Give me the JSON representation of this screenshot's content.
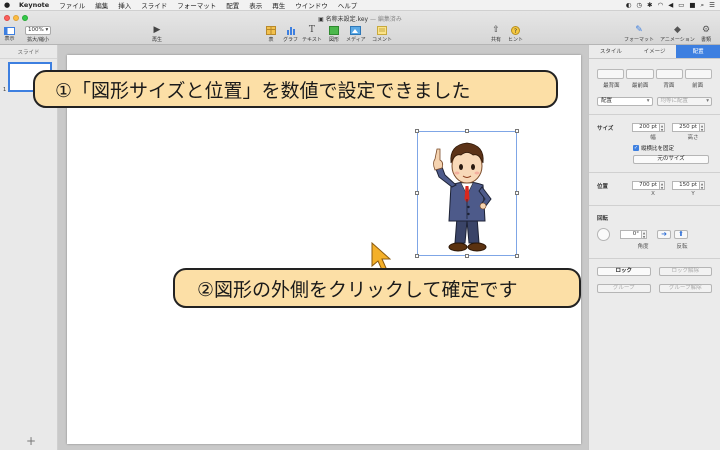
{
  "menubar": {
    "items": [
      "Keynote",
      "ファイル",
      "編集",
      "挿入",
      "スライド",
      "フォーマット",
      "配置",
      "表示",
      "再生",
      "ウインドウ",
      "ヘルプ"
    ]
  },
  "window": {
    "title": "名称未設定.key",
    "edited": "— 編集済み"
  },
  "toolbar": {
    "view_label": "表示",
    "zoom_value": "100%",
    "zoom_label": "拡大/縮小",
    "play_label": "再生",
    "table_label": "表",
    "chart_label": "グラフ",
    "text_label": "テキスト",
    "shape_label": "図形",
    "media_label": "メディア",
    "comment_label": "コメント",
    "share_label": "共有",
    "tips_label": "ヒント",
    "format_label": "フォーマット",
    "animate_label": "アニメーション",
    "document_label": "書類"
  },
  "navigator": {
    "header": "スライド",
    "slide_number": "1",
    "add_icon": "+"
  },
  "inspector": {
    "tabs": [
      "スタイル",
      "イメージ",
      "配置"
    ],
    "active_tab": "配置",
    "arrange_buttons": [
      "最背面",
      "最前面",
      "背面",
      "前面"
    ],
    "align_dropdown": "配置",
    "distribute_dropdown": "均等に配置",
    "size_label": "サイズ",
    "width_value": "200 pt",
    "height_value": "250 pt",
    "width_label": "幅",
    "height_label": "高さ",
    "constrain_label": "縦横比を固定",
    "original_size_button": "元のサイズ",
    "position_label": "位置",
    "x_value": "700 pt",
    "y_value": "150 pt",
    "x_label": "X",
    "y_label": "Y",
    "rotate_label": "回転",
    "angle_value": "0°",
    "angle_label": "角度",
    "flip_label": "反転",
    "lock_button": "ロック",
    "unlock_button": "ロック解除",
    "group_button": "グループ",
    "ungroup_button": "グループ解除"
  },
  "callouts": {
    "first": "①「図形サイズと位置」を数値で設定できました",
    "second": "②図形の外側をクリックして確定です"
  },
  "colors": {
    "accent": "#3d7fe0",
    "callout_fill": "#fcdfa6",
    "cursor": "#f4b02a"
  }
}
